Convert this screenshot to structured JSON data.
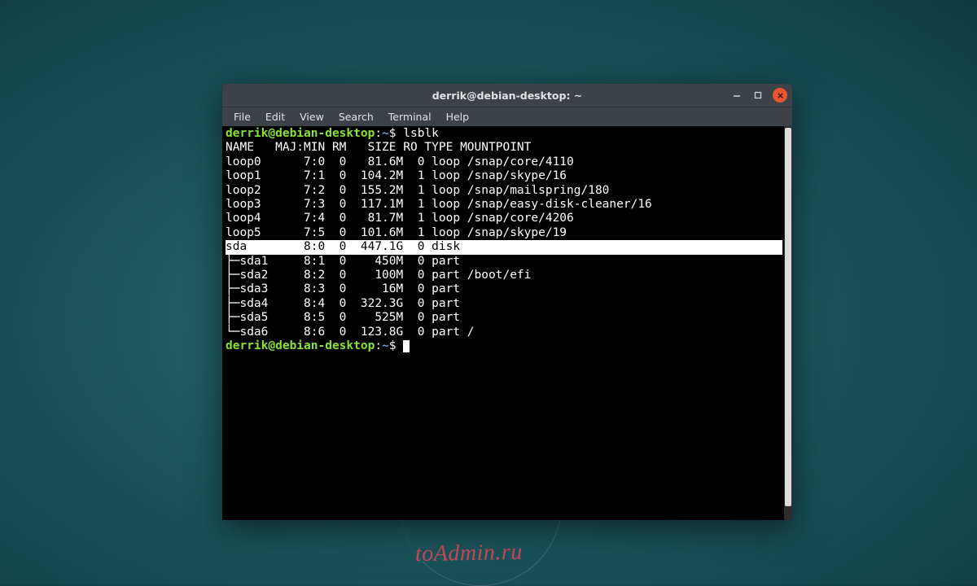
{
  "watermark": "toAdmin.ru",
  "window": {
    "title": "derrik@debian-desktop: ~"
  },
  "menu": {
    "items": [
      "File",
      "Edit",
      "View",
      "Search",
      "Terminal",
      "Help"
    ]
  },
  "prompt": {
    "user_host": "derrik@debian-desktop",
    "separator": ":",
    "path": "~",
    "symbol": "$"
  },
  "command": "lsblk",
  "header": {
    "name": "NAME",
    "majmin": "MAJ:MIN",
    "rm": "RM",
    "size": "SIZE",
    "ro": "RO",
    "type": "TYPE",
    "mountpoint": "MOUNTPOINT"
  },
  "rows": [
    {
      "name": "loop0",
      "tree": "",
      "maj": "7:0",
      "rm": "0",
      "size": "81.6M",
      "ro": "0",
      "type": "loop",
      "mnt": "/snap/core/4110",
      "hl": false
    },
    {
      "name": "loop1",
      "tree": "",
      "maj": "7:1",
      "rm": "0",
      "size": "104.2M",
      "ro": "1",
      "type": "loop",
      "mnt": "/snap/skype/16",
      "hl": false
    },
    {
      "name": "loop2",
      "tree": "",
      "maj": "7:2",
      "rm": "0",
      "size": "155.2M",
      "ro": "1",
      "type": "loop",
      "mnt": "/snap/mailspring/180",
      "hl": false
    },
    {
      "name": "loop3",
      "tree": "",
      "maj": "7:3",
      "rm": "0",
      "size": "117.1M",
      "ro": "1",
      "type": "loop",
      "mnt": "/snap/easy-disk-cleaner/16",
      "hl": false
    },
    {
      "name": "loop4",
      "tree": "",
      "maj": "7:4",
      "rm": "0",
      "size": "81.7M",
      "ro": "1",
      "type": "loop",
      "mnt": "/snap/core/4206",
      "hl": false
    },
    {
      "name": "loop5",
      "tree": "",
      "maj": "7:5",
      "rm": "0",
      "size": "101.6M",
      "ro": "1",
      "type": "loop",
      "mnt": "/snap/skype/19",
      "hl": false
    },
    {
      "name": "sda",
      "tree": "",
      "maj": "8:0",
      "rm": "0",
      "size": "447.1G",
      "ro": "0",
      "type": "disk",
      "mnt": "",
      "hl": true
    },
    {
      "name": "sda1",
      "tree": "├─",
      "maj": "8:1",
      "rm": "0",
      "size": "450M",
      "ro": "0",
      "type": "part",
      "mnt": "",
      "hl": false
    },
    {
      "name": "sda2",
      "tree": "├─",
      "maj": "8:2",
      "rm": "0",
      "size": "100M",
      "ro": "0",
      "type": "part",
      "mnt": "/boot/efi",
      "hl": false
    },
    {
      "name": "sda3",
      "tree": "├─",
      "maj": "8:3",
      "rm": "0",
      "size": "16M",
      "ro": "0",
      "type": "part",
      "mnt": "",
      "hl": false
    },
    {
      "name": "sda4",
      "tree": "├─",
      "maj": "8:4",
      "rm": "0",
      "size": "322.3G",
      "ro": "0",
      "type": "part",
      "mnt": "",
      "hl": false
    },
    {
      "name": "sda5",
      "tree": "├─",
      "maj": "8:5",
      "rm": "0",
      "size": "525M",
      "ro": "0",
      "type": "part",
      "mnt": "",
      "hl": false
    },
    {
      "name": "sda6",
      "tree": "└─",
      "maj": "8:6",
      "rm": "0",
      "size": "123.8G",
      "ro": "0",
      "type": "part",
      "mnt": "/",
      "hl": false
    }
  ]
}
